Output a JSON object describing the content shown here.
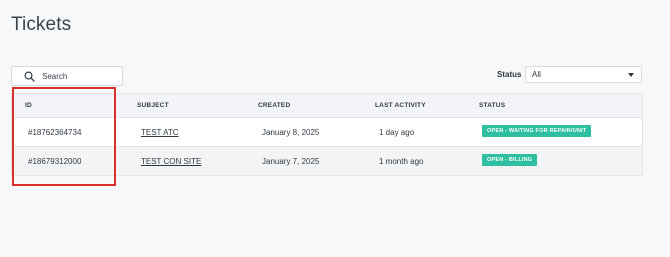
{
  "page": {
    "title": "Tickets"
  },
  "search": {
    "placeholder": "Search",
    "icon": "search-icon"
  },
  "status_filter": {
    "label": "Status",
    "selected": "All"
  },
  "table": {
    "columns": [
      "ID",
      "SUBJECT",
      "CREATED",
      "LAST ACTIVITY",
      "STATUS"
    ],
    "rows": [
      {
        "id": "#18762364734",
        "subject": "TEST ATC",
        "created": "January 8, 2025",
        "last_activity": "1 day ago",
        "status": "OPEN - WAITING FOR REPAIR/UNIT"
      },
      {
        "id": "#18679312000",
        "subject": "TEST CON SITE",
        "created": "January 7, 2025",
        "last_activity": "1 month ago",
        "status": "OPEN - BILLING"
      }
    ]
  },
  "colors": {
    "status_badge": "#2dbf9f",
    "highlight": "#d9302b"
  }
}
